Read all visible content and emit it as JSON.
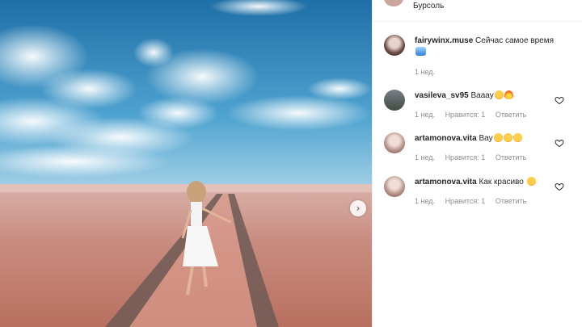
{
  "header": {
    "location": "Бурсоль"
  },
  "caption": {
    "username": "fairywinx.muse",
    "text": "Сейчас самое время",
    "emoji": "wave",
    "time": "1 нед."
  },
  "comments": [
    {
      "username": "vasileva_sv95",
      "text": "Вааау",
      "emojis": [
        "face",
        "fire"
      ],
      "time": "1 нед.",
      "likes": "Нравится: 1",
      "reply": "Ответить"
    },
    {
      "username": "artamonova.vita",
      "text": "Вау",
      "emojis": [
        "face",
        "face",
        "face"
      ],
      "time": "1 нед.",
      "likes": "Нравится: 1",
      "reply": "Ответить"
    },
    {
      "username": "artamonova.vita",
      "text": "Как красиво",
      "emojis": [
        "face"
      ],
      "time": "1 нед.",
      "likes": "Нравится: 1",
      "reply": "Ответить"
    }
  ],
  "icons": {
    "next": "chevron-right-icon",
    "like": "heart-icon"
  }
}
